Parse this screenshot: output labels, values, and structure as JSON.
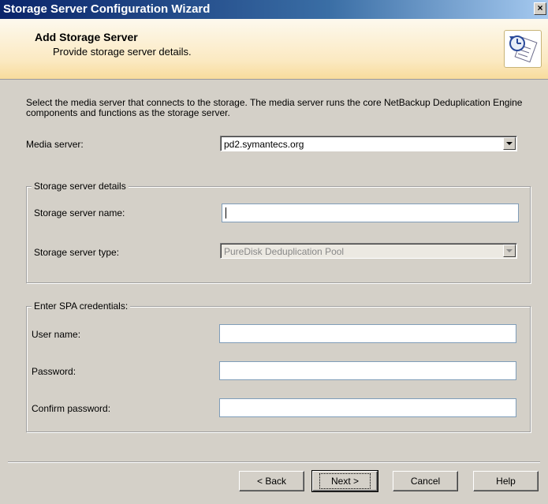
{
  "window": {
    "title": "Storage Server Configuration Wizard",
    "close_label": "×"
  },
  "header": {
    "title": "Add Storage Server",
    "subtitle": "Provide storage server details.",
    "icon": "wizard-document-clock-icon"
  },
  "intro_text": "Select the media server that connects to the storage. The media server runs the core NetBackup Deduplication Engine components and functions as the storage server.",
  "media_server": {
    "label": "Media server:",
    "value": "pd2.symantecs.org"
  },
  "storage_server_details": {
    "legend": "Storage server details",
    "name_label": "Storage server name:",
    "name_value": "",
    "type_label": "Storage server type:",
    "type_value": "PureDisk Deduplication Pool"
  },
  "spa_credentials": {
    "legend": "Enter SPA credentials:",
    "user_label": "User name:",
    "user_value": "",
    "password_label": "Password:",
    "password_value": "",
    "confirm_label": "Confirm password:",
    "confirm_value": ""
  },
  "buttons": {
    "back": "< Back",
    "next": "Next >",
    "cancel": "Cancel",
    "help": "Help"
  }
}
